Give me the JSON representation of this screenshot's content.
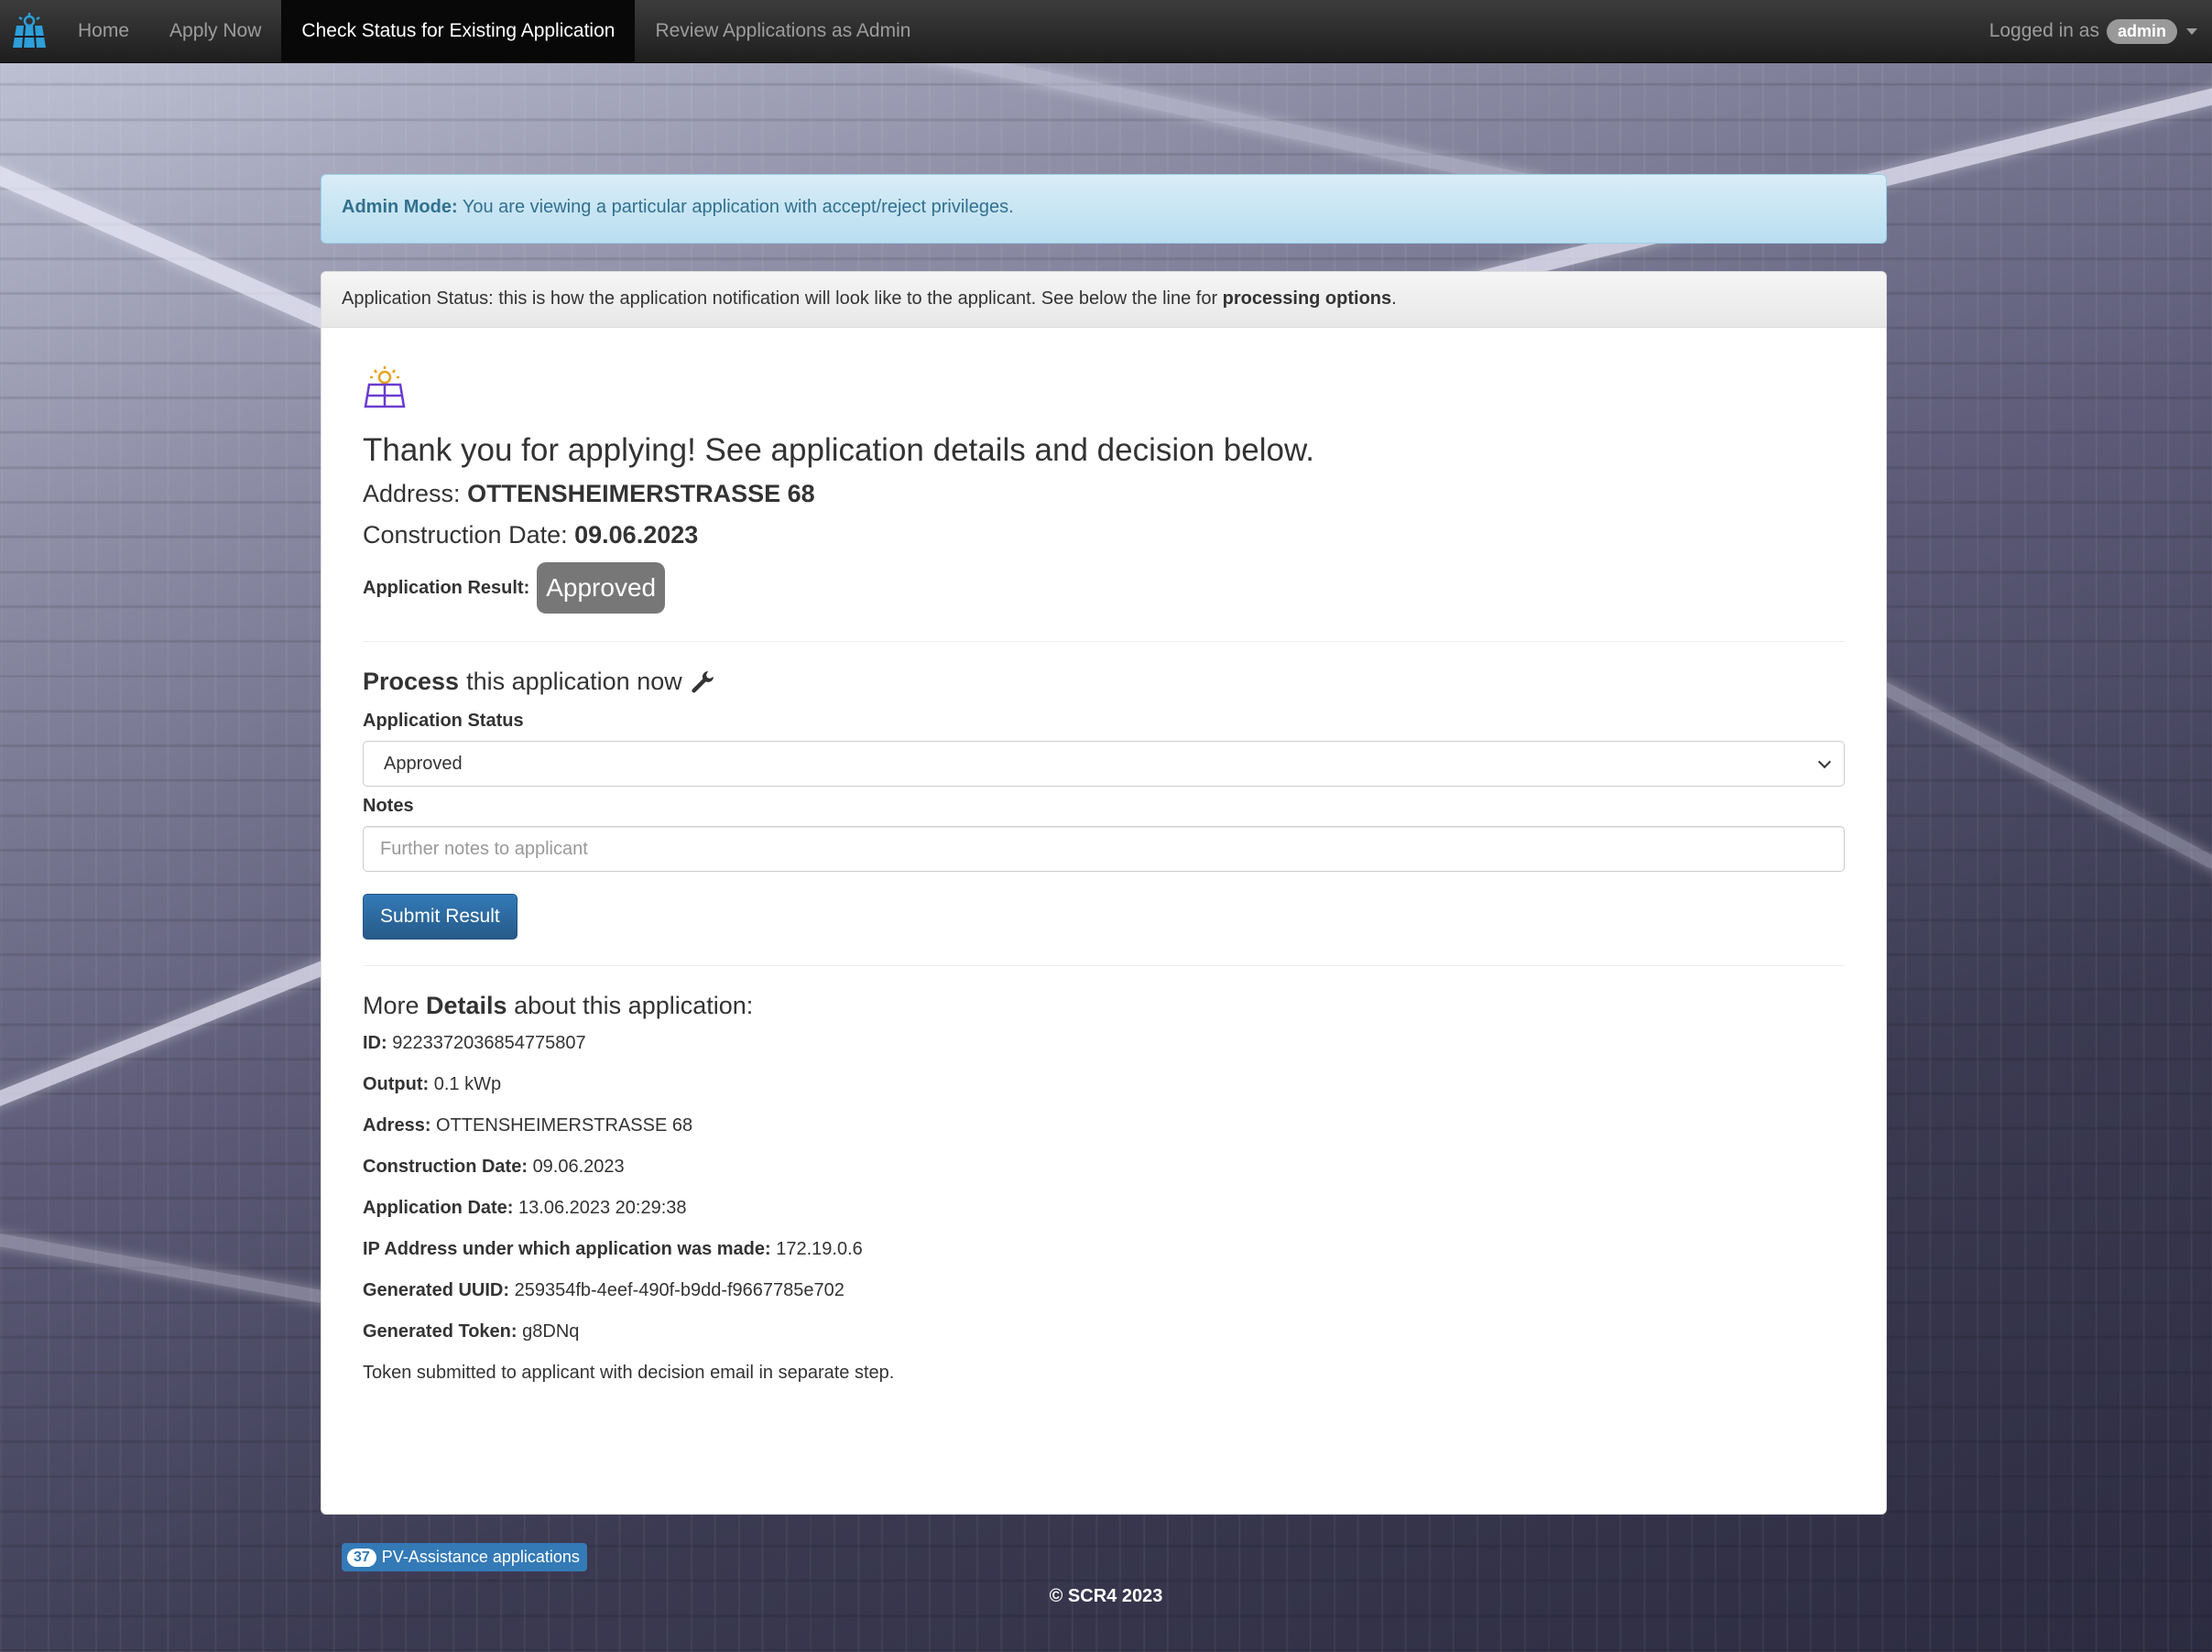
{
  "nav": {
    "items": [
      {
        "label": "Home",
        "active": false
      },
      {
        "label": "Apply Now",
        "active": false
      },
      {
        "label": "Check Status for Existing Application",
        "active": true
      },
      {
        "label": "Review Applications as Admin",
        "active": false
      }
    ],
    "logged_in_text": "Logged in as",
    "username": "admin"
  },
  "alert": {
    "strong": "Admin Mode:",
    "text": "You are viewing a particular application with accept/reject privileges."
  },
  "panel": {
    "heading_text": "Application Status: this is how the application notification will look like to the applicant. See below the line for",
    "heading_bold": "processing options",
    "heading_end": "."
  },
  "status": {
    "thanks": "Thank you for applying! See application details and decision below.",
    "address_label": "Address:",
    "address_value": "OTTENSHEIMERSTRASSE 68",
    "construction_label": "Construction Date:",
    "construction_value": "09.06.2023",
    "result_label": "Application Result:",
    "result_value": "Approved"
  },
  "process": {
    "title_bold": "Process",
    "title_rest": "this application now",
    "status_label": "Application Status",
    "status_selected": "Approved",
    "notes_label": "Notes",
    "notes_placeholder": "Further notes to applicant",
    "notes_value": "",
    "submit_label": "Submit Result"
  },
  "details": {
    "title_pre": "More",
    "title_bold": "Details",
    "title_post": "about this application:",
    "rows": [
      {
        "label": "ID:",
        "value": "9223372036854775807"
      },
      {
        "label": "Output:",
        "value": "0.1 kWp"
      },
      {
        "label": "Adress:",
        "value": "OTTENSHEIMERSTRASSE 68"
      },
      {
        "label": "Construction Date:",
        "value": "09.06.2023"
      },
      {
        "label": "Application Date:",
        "value": "13.06.2023 20:29:38"
      },
      {
        "label": "IP Address under which application was made:",
        "value": "172.19.0.6"
      },
      {
        "label": "Generated UUID:",
        "value": "259354fb-4eef-490f-b9dd-f9667785e702"
      },
      {
        "label": "Generated Token:",
        "value": "g8DNq"
      }
    ],
    "note": "Token submitted to applicant with decision email in separate step."
  },
  "footer": {
    "count": "37",
    "badge_text": "PV-Assistance applications",
    "copyright": "© SCR4 2023"
  },
  "icons": {
    "brand": "solar-panel-icon",
    "status": "solar-panel-sun-icon",
    "wrench": "wrench-icon"
  },
  "colors": {
    "primary": "#337ab7",
    "alert_text": "#31708f",
    "badge_grey": "#777777",
    "navbar": "#222222",
    "panel_icon": "#6a3bd1"
  }
}
